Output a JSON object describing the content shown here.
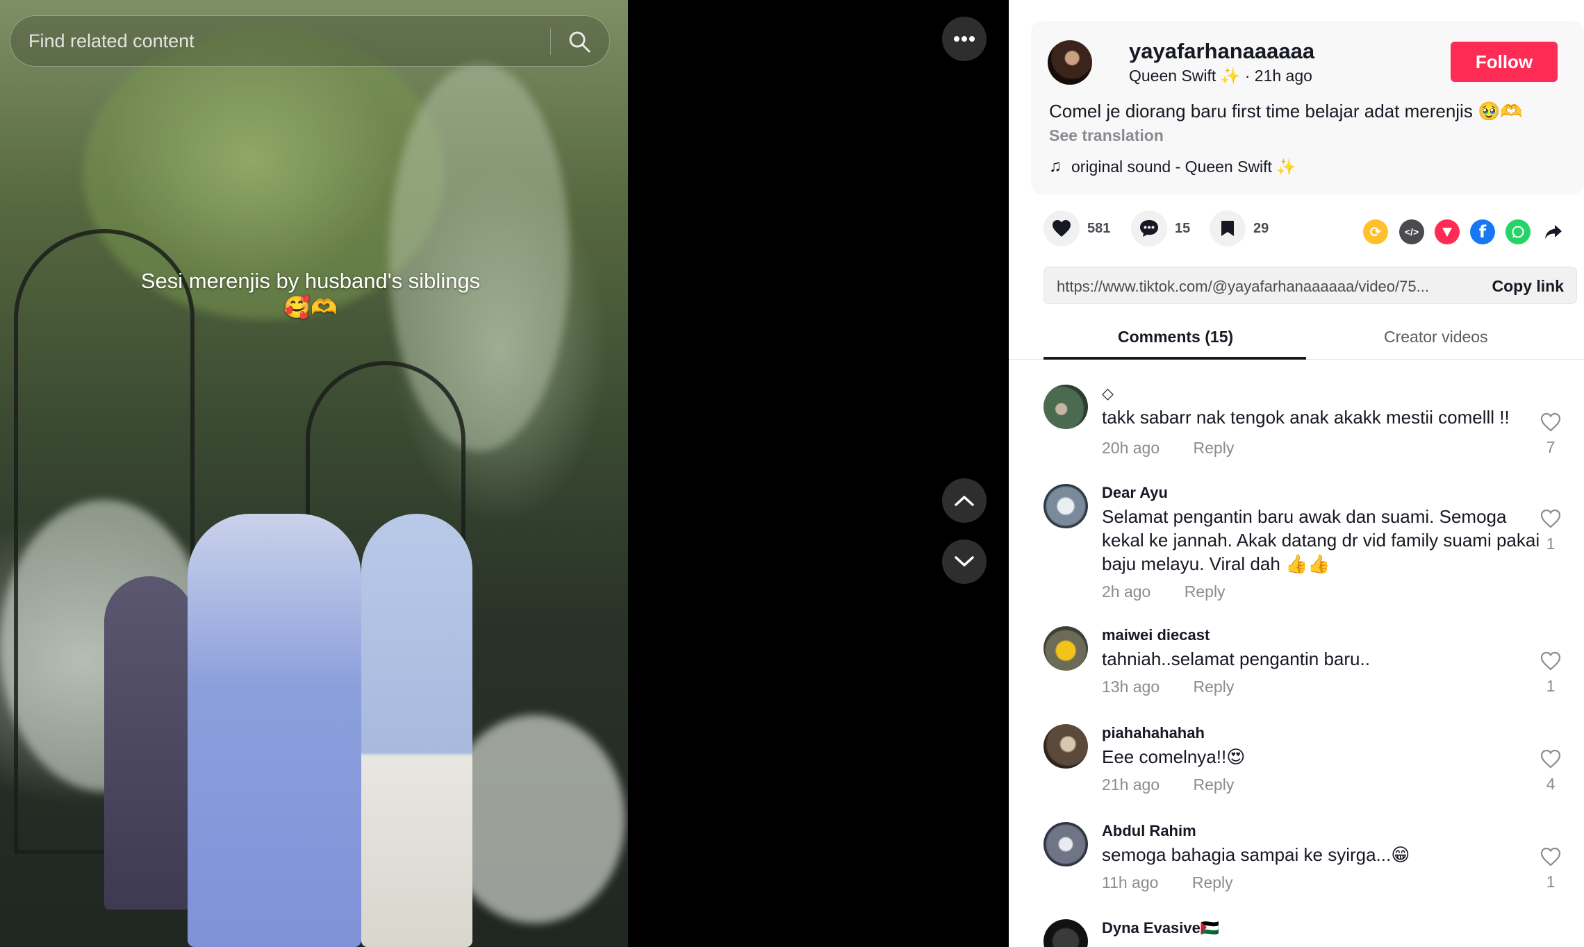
{
  "search": {
    "placeholder": "Find related content",
    "icon": "search-icon"
  },
  "video": {
    "caption": "Sesi merenjis by husband's siblings 🥰🫶"
  },
  "author": {
    "username": "yayafarhanaaaaaa",
    "display_name": "Queen Swift ✨",
    "time_ago": "21h ago",
    "follow_label": "Follow"
  },
  "post": {
    "description": "Comel je diorang baru first time belajar adat merenjis 🥹🫶",
    "see_translation": "See translation",
    "music": "original sound - Queen Swift ✨"
  },
  "actions": {
    "likes": "581",
    "comments": "15",
    "bookmarks": "29"
  },
  "share_icons": [
    "repost-icon",
    "embed-icon",
    "send-icon",
    "facebook-icon",
    "whatsapp-icon",
    "forward-icon"
  ],
  "link": {
    "url": "https://www.tiktok.com/@yayafarhanaaaaaa/video/75...",
    "copy_label": "Copy link"
  },
  "tabs": {
    "comments": "Comments (15)",
    "creator_videos": "Creator videos"
  },
  "comments": [
    {
      "name": "◇",
      "text": "takk sabarr nak tengok anak akakk mestii comelll !!",
      "time": "20h ago",
      "reply": "Reply",
      "likes": "7"
    },
    {
      "name": "Dear Ayu",
      "text": "Selamat pengantin baru awak dan suami. Semoga kekal ke jannah. Akak datang dr vid family suami pakai baju melayu. Viral dah 👍👍",
      "time": "2h ago",
      "reply": "Reply",
      "likes": "1"
    },
    {
      "name": "maiwei diecast",
      "text": "tahniah..selamat pengantin baru..",
      "time": "13h ago",
      "reply": "Reply",
      "likes": "1"
    },
    {
      "name": "piahahahahah",
      "text": "Eee comelnya!!😍",
      "time": "21h ago",
      "reply": "Reply",
      "likes": "4"
    },
    {
      "name": "Abdul Rahim",
      "text": "semoga bahagia sampai ke syirga...😁",
      "time": "11h ago",
      "reply": "Reply",
      "likes": "1"
    },
    {
      "name": "Dyna Evasive🇵🇸",
      "text": "",
      "time": "",
      "reply": "",
      "likes": ""
    }
  ],
  "colors": {
    "accent": "#fe2c55",
    "text": "#161823",
    "muted": "#8a8b91"
  }
}
